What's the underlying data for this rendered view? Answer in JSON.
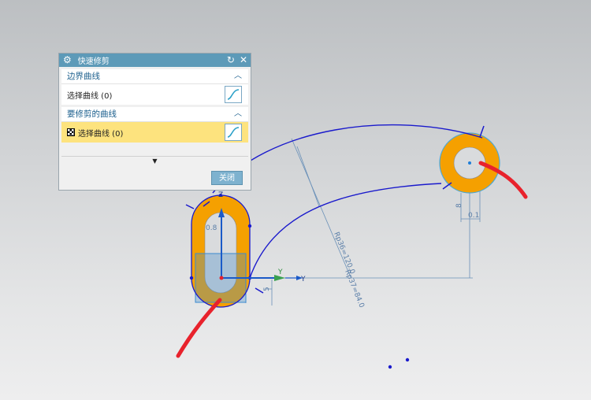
{
  "dialog": {
    "title": "快速修剪",
    "boundary_section": {
      "title": "边界曲线",
      "select_label": "选择曲线 (0)"
    },
    "trim_section": {
      "title": "要修剪的曲线",
      "select_label": "选择曲线 (0)"
    },
    "close_label": "关闭"
  },
  "canvas": {
    "dims": {
      "r_big": "Rp36=120.0",
      "r_small": "Rp37=84.0",
      "d_left": "0.8",
      "d_right": "0.1",
      "d_right_vert": "8",
      "d_small_left": "5"
    },
    "axes": {
      "x_label": "Y",
      "z_label": "Z",
      "y_label": "Y"
    }
  },
  "colors": {
    "sketch_blue": "#1a1acc",
    "dim_blue": "#5a7ea8",
    "fill_orange": "#f5a000",
    "annotation_red": "#e8222c",
    "title_bar": "#5d9ab8",
    "highlight_row": "#fde37e"
  }
}
